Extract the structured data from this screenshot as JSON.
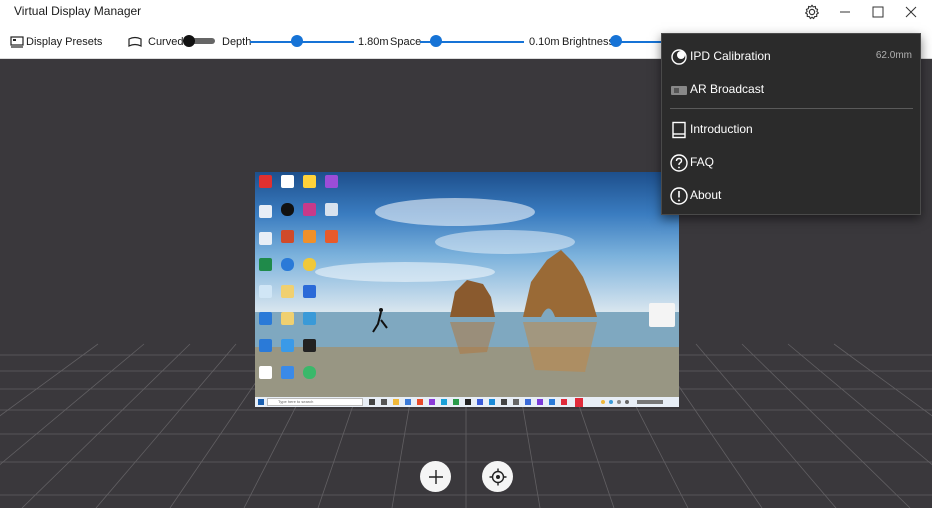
{
  "window": {
    "title": "Virtual Display Manager"
  },
  "toolbar": {
    "display_presets_label": "Display Presets",
    "curved_label": "Curved",
    "curved_on": true,
    "depth_label": "Depth",
    "depth_value": "1.80m",
    "space_label": "Space",
    "space_value": "0.10m",
    "brightness_label": "Brightness"
  },
  "settings_menu": {
    "items": [
      {
        "label": "IPD Calibration",
        "value": "62.0mm",
        "icon": "eye-icon"
      },
      {
        "label": "AR Broadcast",
        "icon": "broadcast-icon"
      },
      {
        "label": "Introduction",
        "icon": "book-icon"
      },
      {
        "label": "FAQ",
        "icon": "question-icon"
      },
      {
        "label": "About",
        "icon": "info-icon"
      }
    ]
  },
  "virtual_desktop": {
    "search_placeholder": "Type here to search"
  },
  "bottom_buttons": {
    "add_icon": "plus-icon",
    "recenter_icon": "crosshair-icon"
  },
  "colors": {
    "accent": "#1673d6",
    "scene_background": "#3a383c",
    "menu_background": "#2b2b2b"
  }
}
